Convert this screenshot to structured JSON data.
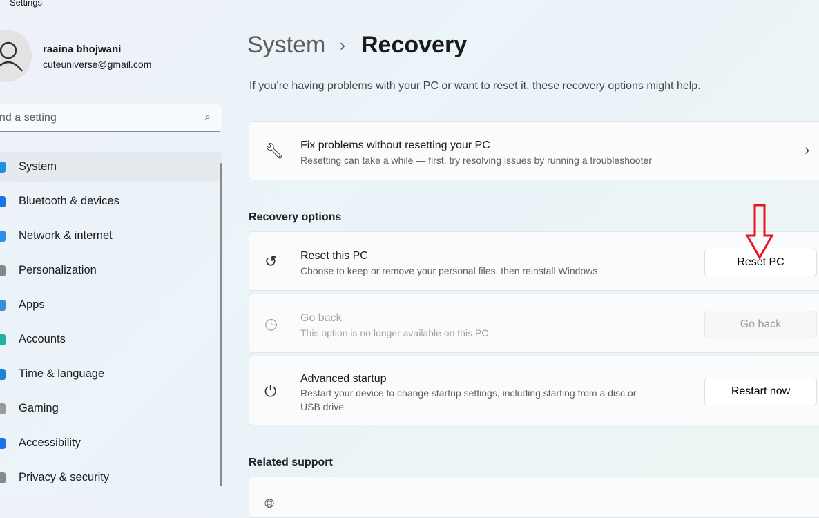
{
  "app": {
    "title": "Settings"
  },
  "user": {
    "name": "raaina bhojwani",
    "email": "cuteuniverse@gmail.com"
  },
  "search": {
    "placeholder": "nd a setting"
  },
  "nav": [
    {
      "label": "System",
      "color": "#1f8fe0"
    },
    {
      "label": "Bluetooth & devices",
      "color": "#1a73e8"
    },
    {
      "label": "Network & internet",
      "color": "#2b8fe6"
    },
    {
      "label": "Personalization",
      "color": "#888888"
    },
    {
      "label": "Apps",
      "color": "#3b8ed8"
    },
    {
      "label": "Accounts",
      "color": "#20b39a"
    },
    {
      "label": "Time & language",
      "color": "#1c84d6"
    },
    {
      "label": "Gaming",
      "color": "#9a9a9a"
    },
    {
      "label": "Accessibility",
      "color": "#1a73e8"
    },
    {
      "label": "Privacy & security",
      "color": "#8a8a8a"
    }
  ],
  "breadcrumb": {
    "parent": "System",
    "current": "Recovery"
  },
  "intro": "If you’re having problems with your PC or want to reset it, these recovery options might help.",
  "fix": {
    "title": "Fix problems without resetting your PC",
    "subtitle": "Resetting can take a while — first, try resolving issues by running a troubleshooter"
  },
  "recovery_header": "Recovery options",
  "reset": {
    "title": "Reset this PC",
    "subtitle": "Choose to keep or remove your personal files, then reinstall Windows",
    "button": "Reset PC"
  },
  "goback": {
    "title": "Go back",
    "subtitle": "This option is no longer available on this PC",
    "button": "Go back"
  },
  "advanced": {
    "title": "Advanced startup",
    "subtitle1": "Restart your device to change startup settings, including starting from a disc or",
    "subtitle2": "USB drive",
    "button": "Restart now"
  },
  "related_header": "Related support",
  "annotation_color": "#e8141c"
}
